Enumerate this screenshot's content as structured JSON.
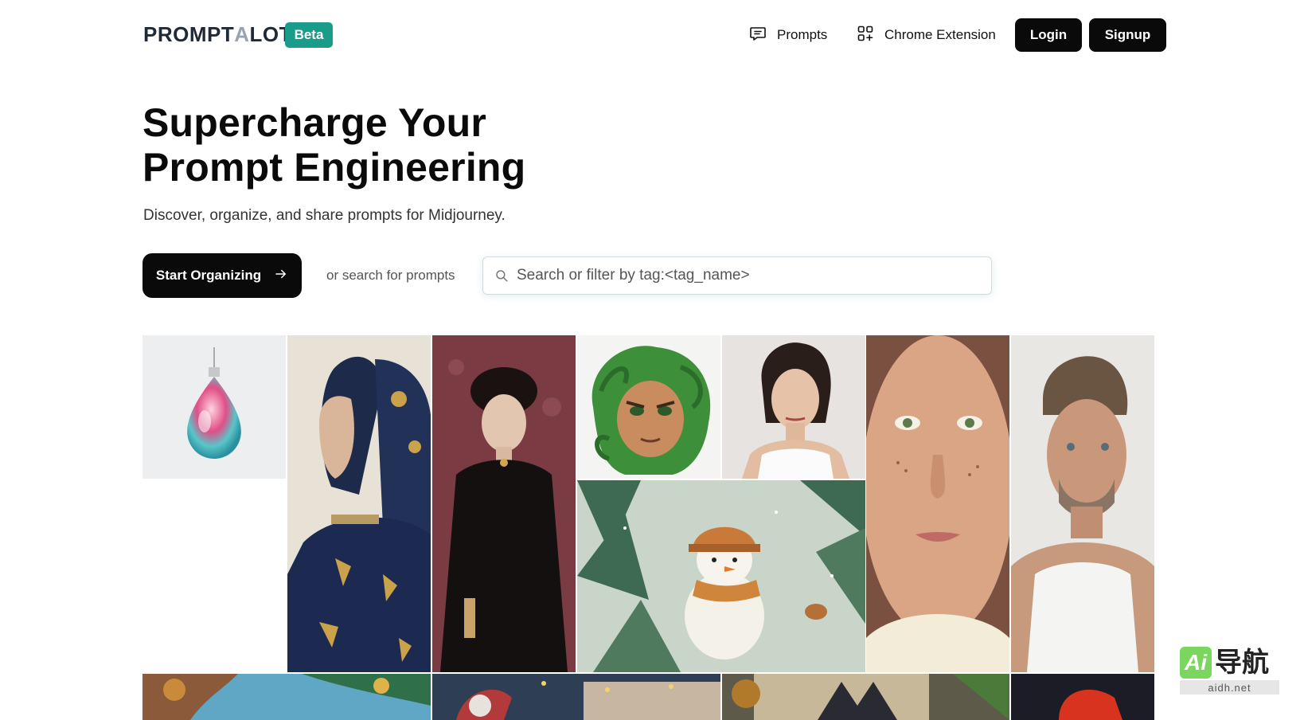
{
  "header": {
    "logo_text_1": "PROMPT",
    "logo_text_2": "A",
    "logo_text_3": "LOT",
    "badge": "Beta",
    "nav_prompts": "Prompts",
    "nav_extension": "Chrome Extension",
    "login": "Login",
    "signup": "Signup"
  },
  "hero": {
    "title_line_1": "Supercharge Your",
    "title_line_2": "Prompt Engineering",
    "subtitle": "Discover, organize, and share prompts for Midjourney.",
    "cta": "Start Organizing",
    "or_text": "or search for prompts",
    "search_placeholder": "Search or filter by tag:<tag_name>"
  },
  "gallery": {
    "images": [
      "glass-ornament-image",
      "mosaic-woman-portrait-image",
      "victorian-woman-portrait-image",
      "green-hair-character-image",
      "woman-white-top-image",
      "snowman-forest-image",
      "freckled-woman-image",
      "man-tank-top-image",
      "tree-landscape-image",
      "holiday-street-image",
      "fox-painting-image",
      "red-object-image"
    ]
  },
  "watermark": {
    "ai": "Ai",
    "cn": "导航",
    "url": "aidh.net"
  },
  "colors": {
    "accent": "#1a9c8a",
    "button": "#0a0a0a"
  }
}
